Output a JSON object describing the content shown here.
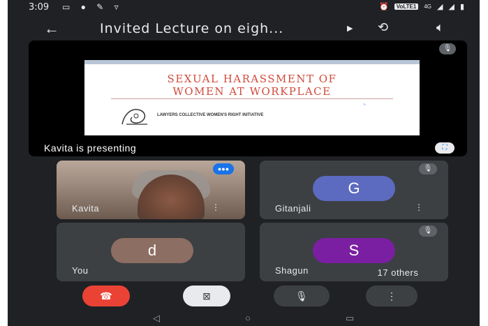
{
  "status_bar": {
    "time": "3:09",
    "left_icons": "▭ ● ✎ ▿",
    "volte": "VoLTE1",
    "network": "4G"
  },
  "app_bar": {
    "title": "Invited Lecture on eigh..."
  },
  "presentation": {
    "slide_title_line1": "SEXUAL HARASSMENT OF",
    "slide_title_line2": "WOMEN AT WORKPLACE",
    "slide_org": "LAWYERS COLLECTIVE WOMEN'S RIGHT INITIATIVE",
    "presenter_label": "Kavita is presenting"
  },
  "participants": [
    {
      "name": "Kavita"
    },
    {
      "name": "Gitanjali",
      "initial": "G",
      "color": "#5c6bc0"
    },
    {
      "name": "You",
      "initial": "d",
      "color": "#8d6e63"
    },
    {
      "name": "Shagun",
      "initial": "S",
      "color": "#7b1fa2"
    }
  ],
  "others_label": "17 others",
  "colors": {
    "end_call": "#ea4335",
    "camera_off_btn": "#e8eaed",
    "control_bg": "#3c4043",
    "screen_bg": "#202124"
  }
}
